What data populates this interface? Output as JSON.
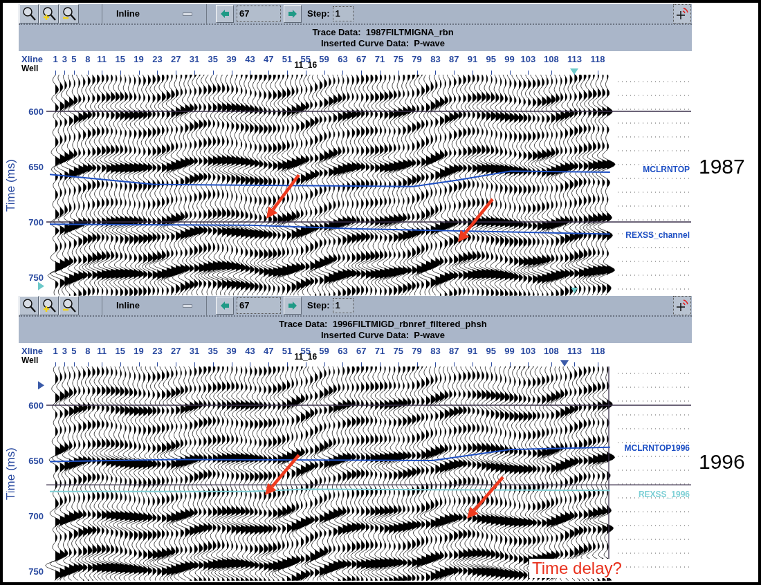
{
  "panels": [
    {
      "toolbar": {
        "dropdown": "Inline",
        "inline_value": "67",
        "step_label": "Step:",
        "step_value": "1"
      },
      "header": [
        "Trace Data:  1987FILTMIGNA_rbn",
        "Inserted Curve Data:  P-wave"
      ],
      "xline_label": "Xline",
      "well_label": "Well",
      "xlines": [
        "1",
        "3",
        "5",
        "8",
        "11",
        "15",
        "19",
        "23",
        "27",
        "31",
        "35",
        "39",
        "43",
        "47",
        "51",
        "55",
        "59",
        "63",
        "67",
        "71",
        "75",
        "79",
        "83",
        "87",
        "91",
        "95",
        "99",
        "103",
        "108",
        "113",
        "118"
      ],
      "well_name": "11_16",
      "axis_title": "Time (ms)",
      "time_labels": [
        "600",
        "650",
        "700",
        "750"
      ],
      "horizons": [
        {
          "label": "MCLRNTOP",
          "color": "#1d4fc4"
        },
        {
          "label": "REXSS_channel",
          "color": "#1d4fc4"
        }
      ],
      "year": "1987"
    },
    {
      "toolbar": {
        "dropdown": "Inline",
        "inline_value": "67",
        "step_label": "Step:",
        "step_value": "1"
      },
      "header": [
        "Trace Data:  1996FILTMIGD_rbnref_filtered_phsh",
        "Inserted Curve Data:  P-wave"
      ],
      "xline_label": "Xline",
      "well_label": "Well",
      "xlines": [
        "1",
        "3",
        "5",
        "8",
        "11",
        "15",
        "19",
        "23",
        "27",
        "31",
        "35",
        "39",
        "43",
        "47",
        "51",
        "55",
        "59",
        "63",
        "67",
        "71",
        "75",
        "79",
        "83",
        "87",
        "91",
        "95",
        "99",
        "103",
        "108",
        "113",
        "118"
      ],
      "well_name": "11_16",
      "axis_title": "Time (ms)",
      "time_labels": [
        "600",
        "650",
        "700",
        "750"
      ],
      "horizons": [
        {
          "label": "MCLRNTOP1996",
          "color": "#1d4fc4"
        },
        {
          "label": "REXSS_1996",
          "color": "#7fd0d6"
        }
      ],
      "year": "1996",
      "annotation": "Time delay?"
    }
  ]
}
